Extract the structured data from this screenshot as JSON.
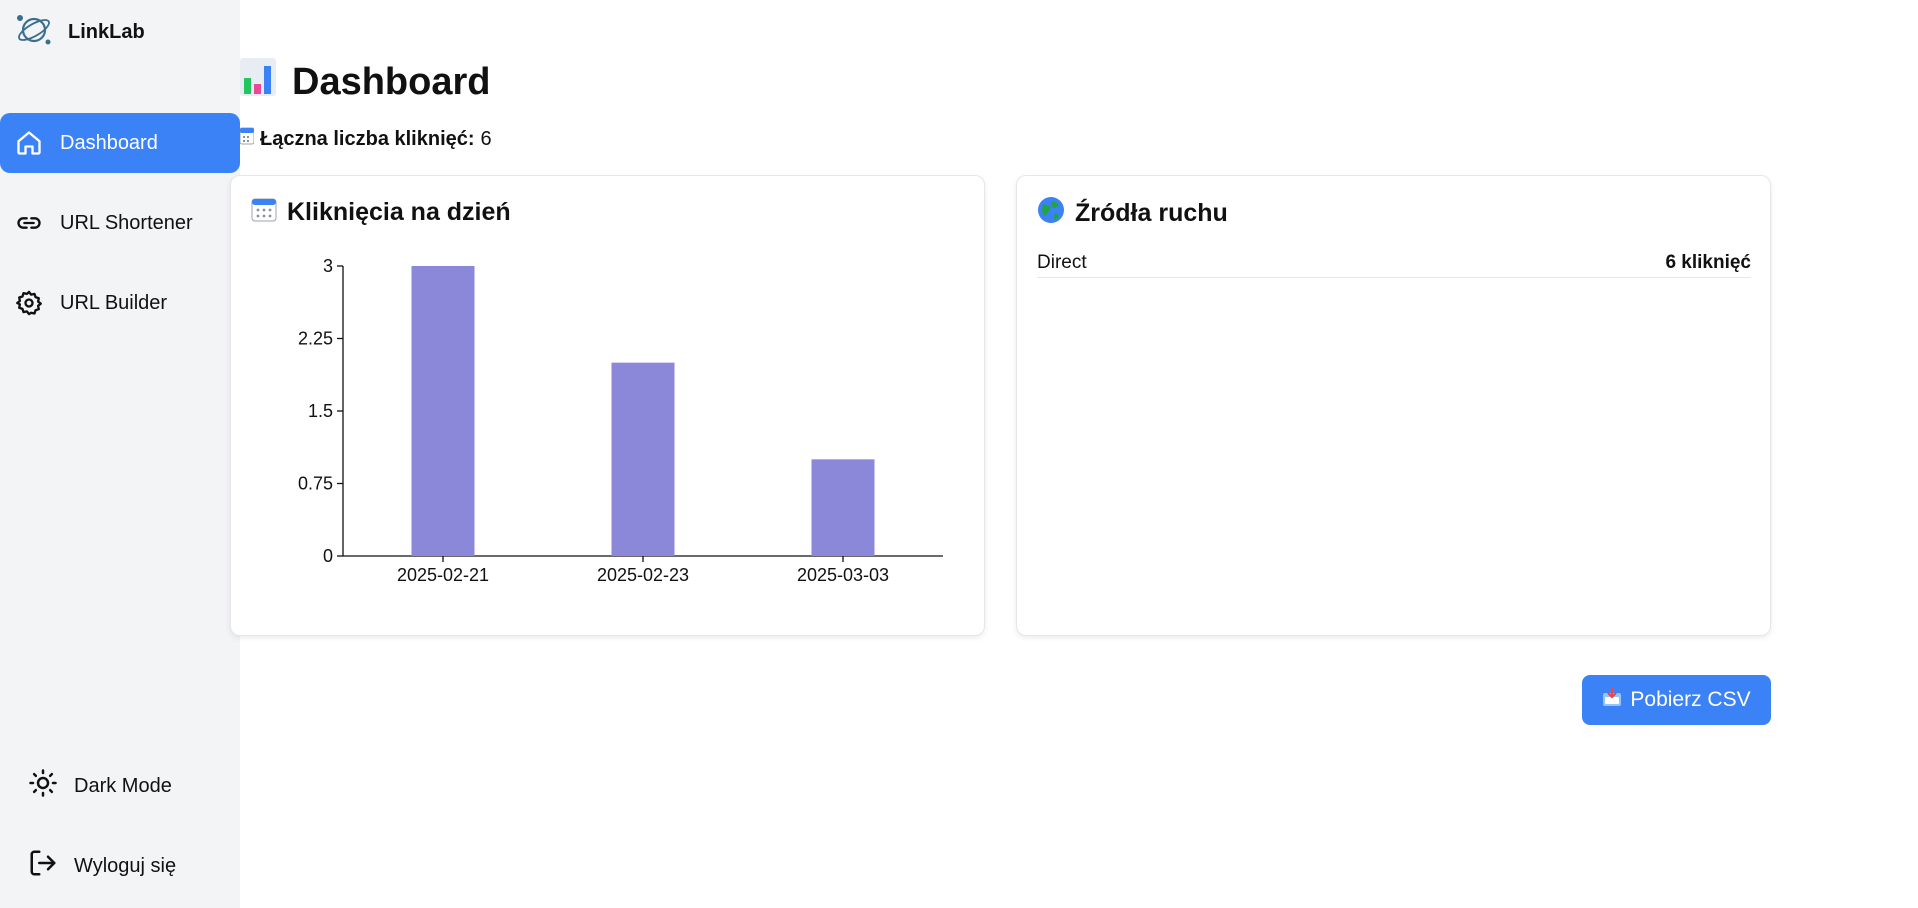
{
  "app": {
    "name": "LinkLab"
  },
  "sidebar": {
    "items": [
      {
        "label": "Dashboard",
        "icon": "home-icon",
        "active": true
      },
      {
        "label": "URL Shortener",
        "icon": "link-icon",
        "active": false
      },
      {
        "label": "URL Builder",
        "icon": "gear-icon",
        "active": false
      }
    ],
    "bottom": [
      {
        "label": "Dark Mode",
        "icon": "sun-icon"
      },
      {
        "label": "Wyloguj się",
        "icon": "logout-icon"
      }
    ]
  },
  "page": {
    "title": "Dashboard",
    "total_clicks_label": "Łączna liczba kliknięć:",
    "total_clicks_value": "6"
  },
  "clicks_card": {
    "title": "Kliknięcia na dzień"
  },
  "sources_card": {
    "title": "Źródła ruchu",
    "rows": [
      {
        "source": "Direct",
        "count": "6 kliknięć"
      }
    ]
  },
  "csv_button": {
    "label": "Pobierz CSV"
  },
  "colors": {
    "accent": "#3b82f6",
    "bar": "#8b87d9",
    "sidebar_bg": "#f3f4f6"
  },
  "chart_data": {
    "type": "bar",
    "categories": [
      "2025-02-21",
      "2025-02-23",
      "2025-03-03"
    ],
    "values": [
      3,
      2,
      1
    ],
    "ylim": [
      0,
      3
    ],
    "yticks": [
      "0",
      "0.75",
      "1.5",
      "2.25",
      "3"
    ],
    "grid": false
  }
}
